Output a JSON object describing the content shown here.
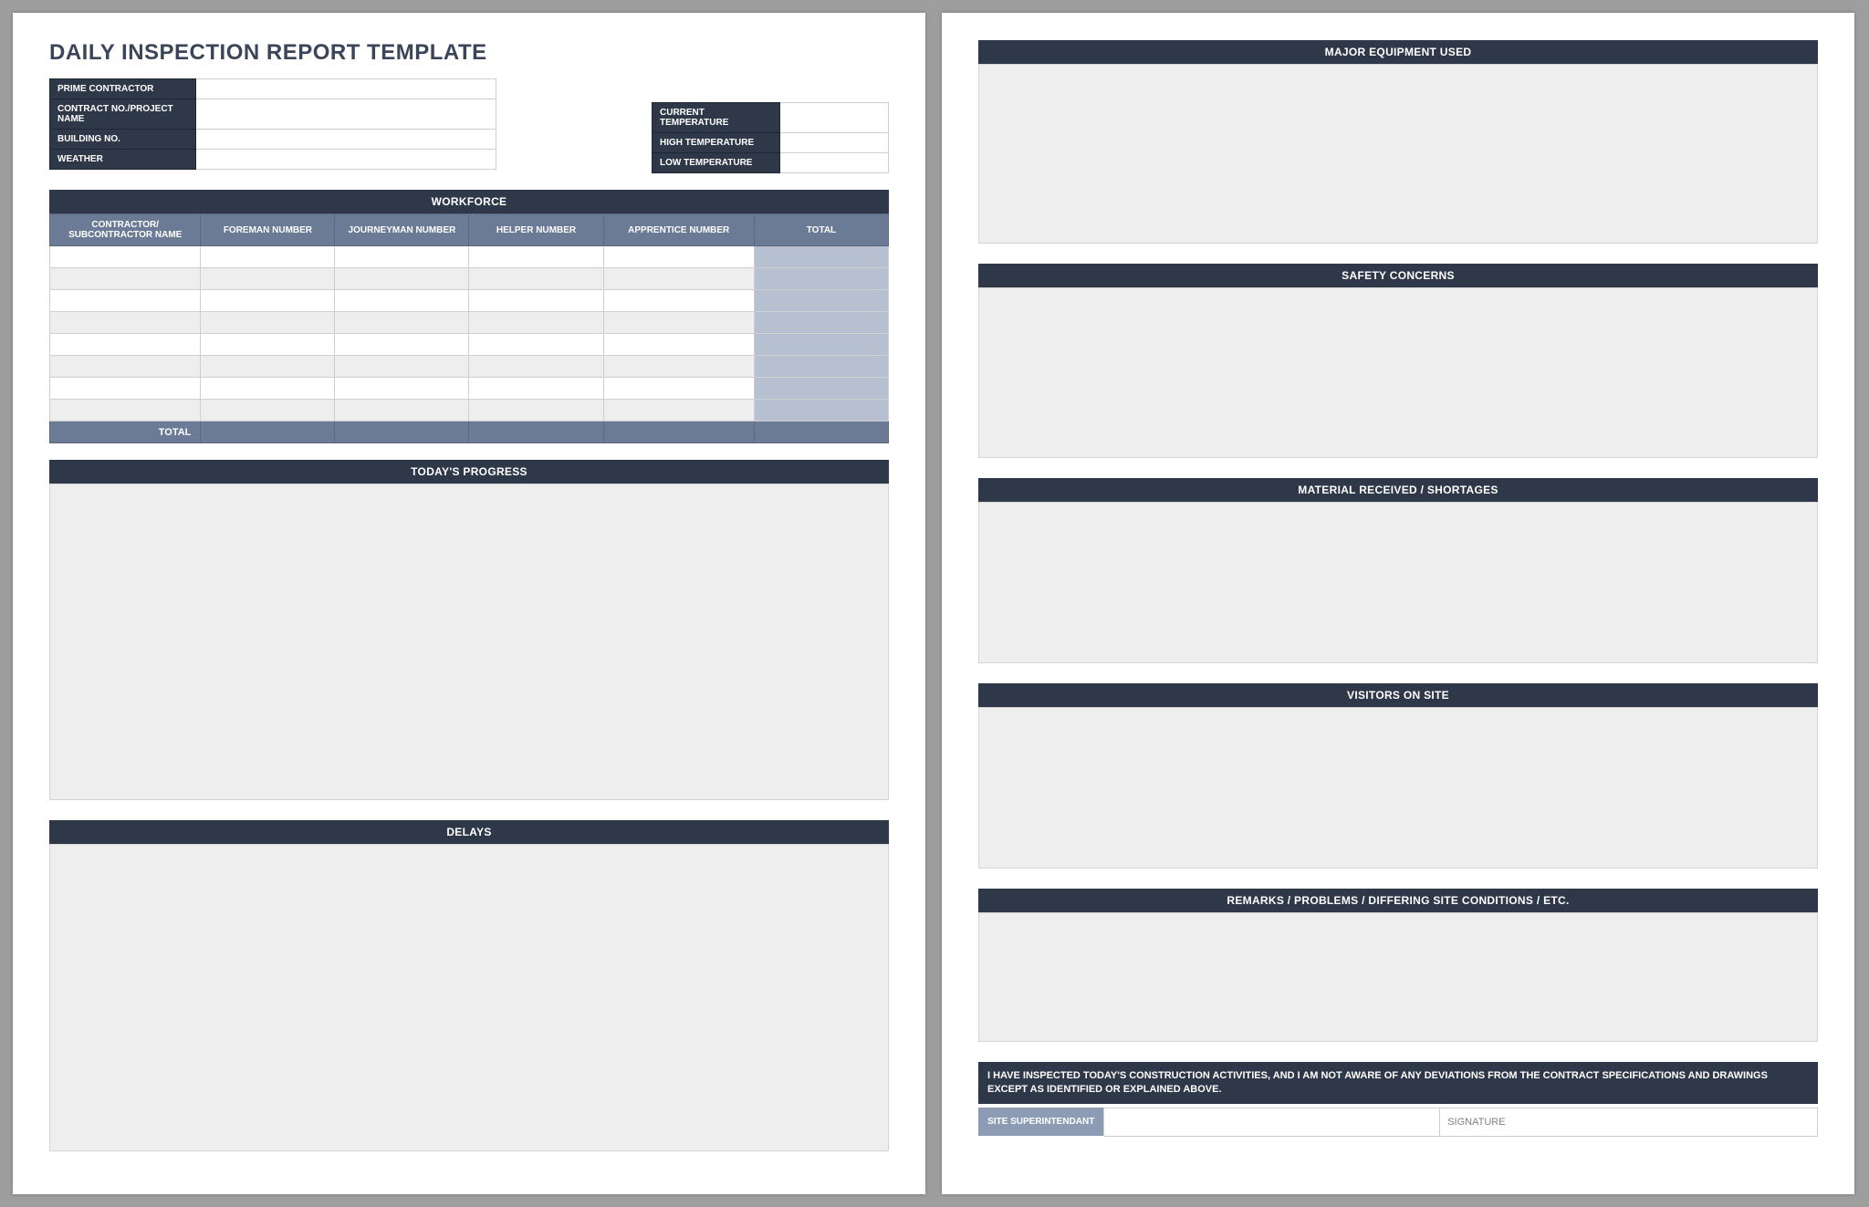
{
  "title": "DAILY INSPECTION REPORT TEMPLATE",
  "info_left": {
    "prime_contractor": "PRIME CONTRACTOR",
    "contract_project": "CONTRACT NO./PROJECT NAME",
    "building_no": "BUILDING NO.",
    "weather": "WEATHER"
  },
  "info_right": {
    "current_temp": "CURRENT TEMPERATURE",
    "high_temp": "HIGH TEMPERATURE",
    "low_temp": "LOW TEMPERATURE"
  },
  "workforce": {
    "title": "WORKFORCE",
    "cols": {
      "contractor": "CONTRACTOR/ SUBCONTRACTOR NAME",
      "foreman": "FOREMAN NUMBER",
      "journeyman": "JOURNEYMAN NUMBER",
      "helper": "HELPER NUMBER",
      "apprentice": "APPRENTICE NUMBER",
      "total": "TOTAL"
    },
    "total_label": "TOTAL"
  },
  "sections_p1": {
    "progress": "TODAY'S PROGRESS",
    "delays": "DELAYS"
  },
  "sections_p2": {
    "equipment": "MAJOR EQUIPMENT USED",
    "safety": "SAFETY CONCERNS",
    "material": "MATERIAL RECEIVED / SHORTAGES",
    "visitors": "VISITORS ON SITE",
    "remarks": "REMARKS / PROBLEMS / DIFFERING SITE CONDITIONS / ETC."
  },
  "attestation": "I HAVE INSPECTED TODAY'S CONSTRUCTION ACTIVITIES, AND I AM NOT AWARE OF ANY DEVIATIONS FROM THE CONTRACT SPECIFICATIONS AND DRAWINGS EXCEPT AS IDENTIFIED OR EXPLAINED ABOVE.",
  "signature": {
    "superintendant": "SITE SUPERINTENDANT",
    "signature": "SIGNATURE"
  }
}
